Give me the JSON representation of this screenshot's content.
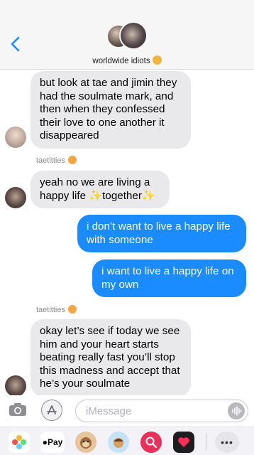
{
  "header": {
    "back_label": "<",
    "group_name": "worldwide idiots"
  },
  "messages": [
    {
      "direction": "incoming",
      "text": "but look at tae and jimin they had the soulmate mark, and then when they confessed their love to one another it disappeared"
    },
    {
      "sender": "taetitties"
    },
    {
      "direction": "incoming",
      "text_before": "yeah no we are living a happy life ",
      "sparkle": "✨",
      "text_mid": "together"
    },
    {
      "direction": "outgoing",
      "text": "i don’t want to live a happy life with someone"
    },
    {
      "direction": "outgoing",
      "text": "i want to live a happy life on my own"
    },
    {
      "sender": "taetitties"
    },
    {
      "direction": "incoming",
      "text": "okay let’s see if today we see him and your heart starts beating really fast you’ll stop this madness and accept that he’s your soulmate"
    }
  ],
  "input": {
    "placeholder": "iMessage"
  },
  "drawer": {
    "pay_label": "Pay",
    "more_label": "•••"
  },
  "colors": {
    "outgoing_bubble": "#1a8cff",
    "incoming_bubble": "#e9e9eb"
  }
}
